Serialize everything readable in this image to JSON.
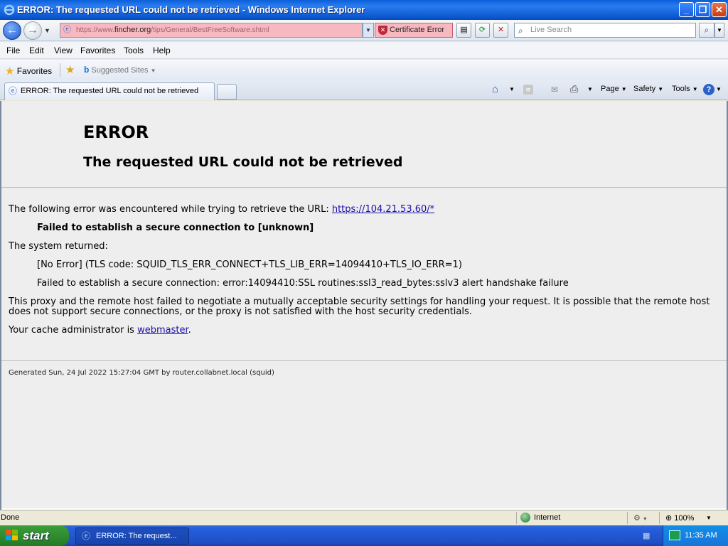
{
  "window": {
    "title": "ERROR: The requested URL could not be retrieved - Windows Internet Explorer"
  },
  "address_bar": {
    "url_prefix": "https://www.",
    "url_domain": "fincher.org",
    "url_suffix": "/tips/General/BestFreeSoftware.shtml",
    "cert_error": "Certificate Error"
  },
  "search": {
    "placeholder": "Live Search"
  },
  "menu": [
    "File",
    "Edit",
    "View",
    "Favorites",
    "Tools",
    "Help"
  ],
  "favorites_bar": {
    "favorites": "Favorites",
    "suggested_sites": "Suggested Sites"
  },
  "tab": {
    "label": "ERROR: The requested URL could not be retrieved"
  },
  "command_bar": {
    "page": "Page",
    "safety": "Safety",
    "tools": "Tools"
  },
  "page": {
    "heading": "ERROR",
    "subheading": "The requested URL could not be retrieved",
    "intro_text": "The following error was encountered while trying to retrieve the URL: ",
    "intro_link": "https://104.21.53.60/*",
    "error_bold": "Failed to establish a secure connection to [unknown]",
    "system_returned": "The system returned:",
    "tls_code": "[No Error] (TLS code: SQUID_TLS_ERR_CONNECT+TLS_LIB_ERR=14094410+TLS_IO_ERR=1)",
    "ssl_detail": "Failed to establish a secure connection: error:14094410:SSL routines:ssl3_read_bytes:sslv3 alert handshake failure",
    "explanation": "This proxy and the remote host failed to negotiate a mutually acceptable security settings for handling your request. It is possible that the remote host does not support secure connections, or the proxy is not satisfied with the host security credentials.",
    "admin_text": "Your cache administrator is ",
    "admin_link": "webmaster",
    "admin_end": ".",
    "footer": "Generated Sun, 24 Jul 2022 15:27:04 GMT by router.collabnet.local (squid)"
  },
  "status_bar": {
    "status": "Done",
    "zone": "Internet",
    "zoom": "100%"
  },
  "taskbar": {
    "start": "start",
    "task_label": "ERROR: The request...",
    "clock": "11:35 AM"
  },
  "colors": {
    "titlebar": "#0a5fd8",
    "cert_error_bg": "#f8b8c0",
    "page_bg": "#eeeeee",
    "link": "#1a0dab",
    "start_green": "#3c9d3c"
  }
}
